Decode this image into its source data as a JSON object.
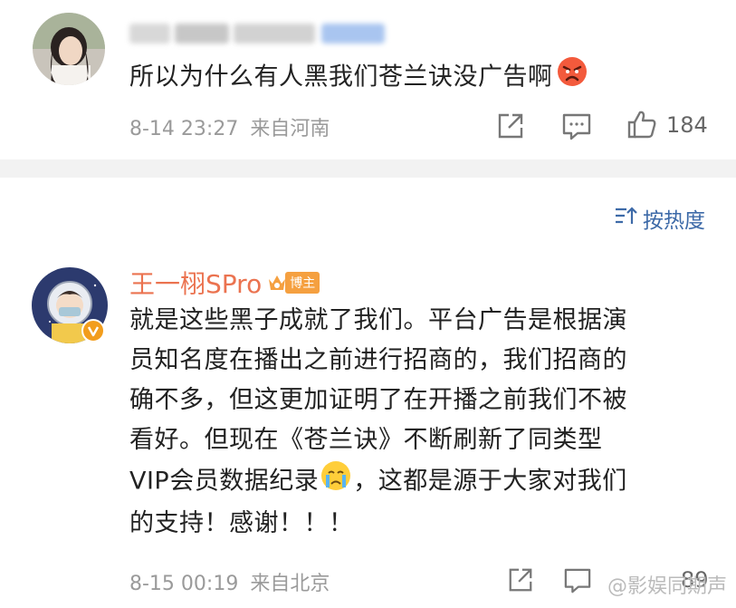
{
  "comment1": {
    "text": "所以为什么有人黑我们苍兰诀没广告啊",
    "emoji": "angry-face",
    "time": "8-14 23:27",
    "location": "来自河南",
    "likes": "184"
  },
  "sort": {
    "label": "按热度",
    "icon": "sort-icon"
  },
  "comment2": {
    "username": "王一栩SPro",
    "badge": "博主",
    "lines": [
      "就是这些黑子成就了我们。平台广告是根据演",
      "员知名度在播出之前进行招商的，我们招商的",
      "确不多，但这更加证明了在开播之前我们不被",
      "看好。但现在《苍兰诀》不断刷新了同类型",
      "VIP会员数据纪录",
      "，这都是源于大家对我们",
      "的支持！感谢！！！"
    ],
    "emoji": "crying-face",
    "time": "8-15 00:19",
    "location": "来自北京",
    "likes": "89"
  },
  "watermark": "@影娱同期声",
  "colors": {
    "accent_link": "#3d6aa8",
    "username": "#eb7350",
    "badge": "#f5a040",
    "divider": "#f2f2f2"
  }
}
